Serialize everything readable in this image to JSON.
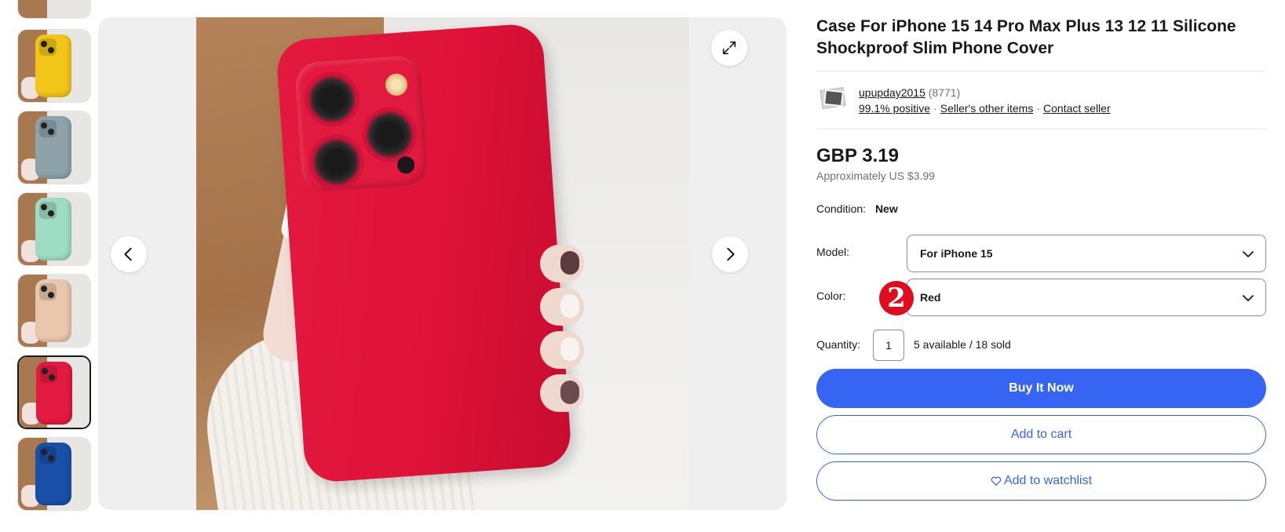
{
  "colors": {
    "accent": "#3665f3",
    "marker": "#e00b1c",
    "text": "#191919",
    "muted": "#707070"
  },
  "thumbnails": [
    {
      "label": "",
      "color": "#d9c9bb"
    },
    {
      "label": "",
      "color": "#f2c51a"
    },
    {
      "label": "",
      "color": "#8da2a9"
    },
    {
      "label": "",
      "color": "#9fdcc4"
    },
    {
      "label": "",
      "color": "#e8c7ad"
    },
    {
      "label": "",
      "color": "#e31a40",
      "selected": true
    },
    {
      "label": "",
      "color": "#1a4fa8"
    }
  ],
  "gallery": {
    "prev_icon": "chevron-left-icon",
    "next_icon": "chevron-right-icon",
    "expand_icon": "expand-icon"
  },
  "product": {
    "title": "Case For iPhone 15 14 Pro Max Plus 13 12 11 Silicone Shockproof Slim Phone Cover",
    "seller": {
      "name": "upupday2015",
      "feedback_count": "(8771)",
      "positive": "99.1% positive",
      "other_items": "Seller's other items",
      "contact": "Contact seller"
    },
    "price": "GBP 3.19",
    "approx": "Approximately US $3.99",
    "condition_label": "Condition:",
    "condition_value": "New",
    "model_label": "Model:",
    "model_value": "For iPhone 15",
    "color_label": "Color:",
    "color_value": "Red",
    "marker": "2",
    "quantity_label": "Quantity:",
    "quantity_value": "1",
    "availability": "5 available / 18 sold",
    "buy_now": "Buy It Now",
    "add_to_cart": "Add to cart",
    "add_to_watchlist": "Add to watchlist"
  }
}
